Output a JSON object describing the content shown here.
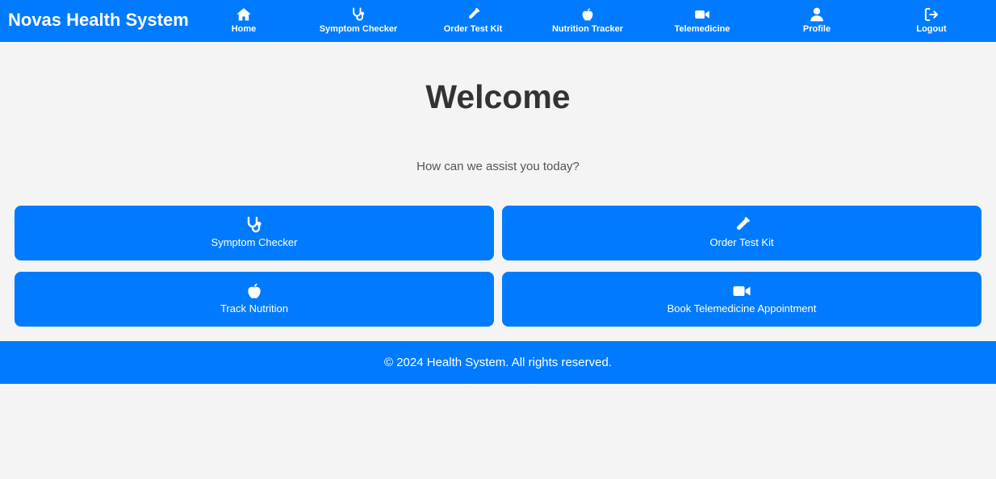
{
  "brand": "Novas Health System",
  "nav": [
    {
      "label": "Home",
      "icon": "home-icon"
    },
    {
      "label": "Symptom Checker",
      "icon": "stethoscope-icon"
    },
    {
      "label": "Order Test Kit",
      "icon": "test-tube-icon"
    },
    {
      "label": "Nutrition Tracker",
      "icon": "apple-icon"
    },
    {
      "label": "Telemedicine",
      "icon": "video-icon"
    },
    {
      "label": "Profile",
      "icon": "user-icon"
    },
    {
      "label": "Logout",
      "icon": "logout-icon"
    }
  ],
  "main": {
    "title": "Welcome",
    "subtitle": "How can we assist you today?"
  },
  "cards": [
    {
      "label": "Symptom Checker",
      "icon": "stethoscope-icon"
    },
    {
      "label": "Order Test Kit",
      "icon": "test-tube-icon"
    },
    {
      "label": "Track Nutrition",
      "icon": "apple-icon"
    },
    {
      "label": "Book Telemedicine Appointment",
      "icon": "video-icon"
    }
  ],
  "footer": "© 2024 Health System. All rights reserved.",
  "colors": {
    "primary": "#007bff",
    "background": "#f4f4f4",
    "text": "#333333"
  }
}
